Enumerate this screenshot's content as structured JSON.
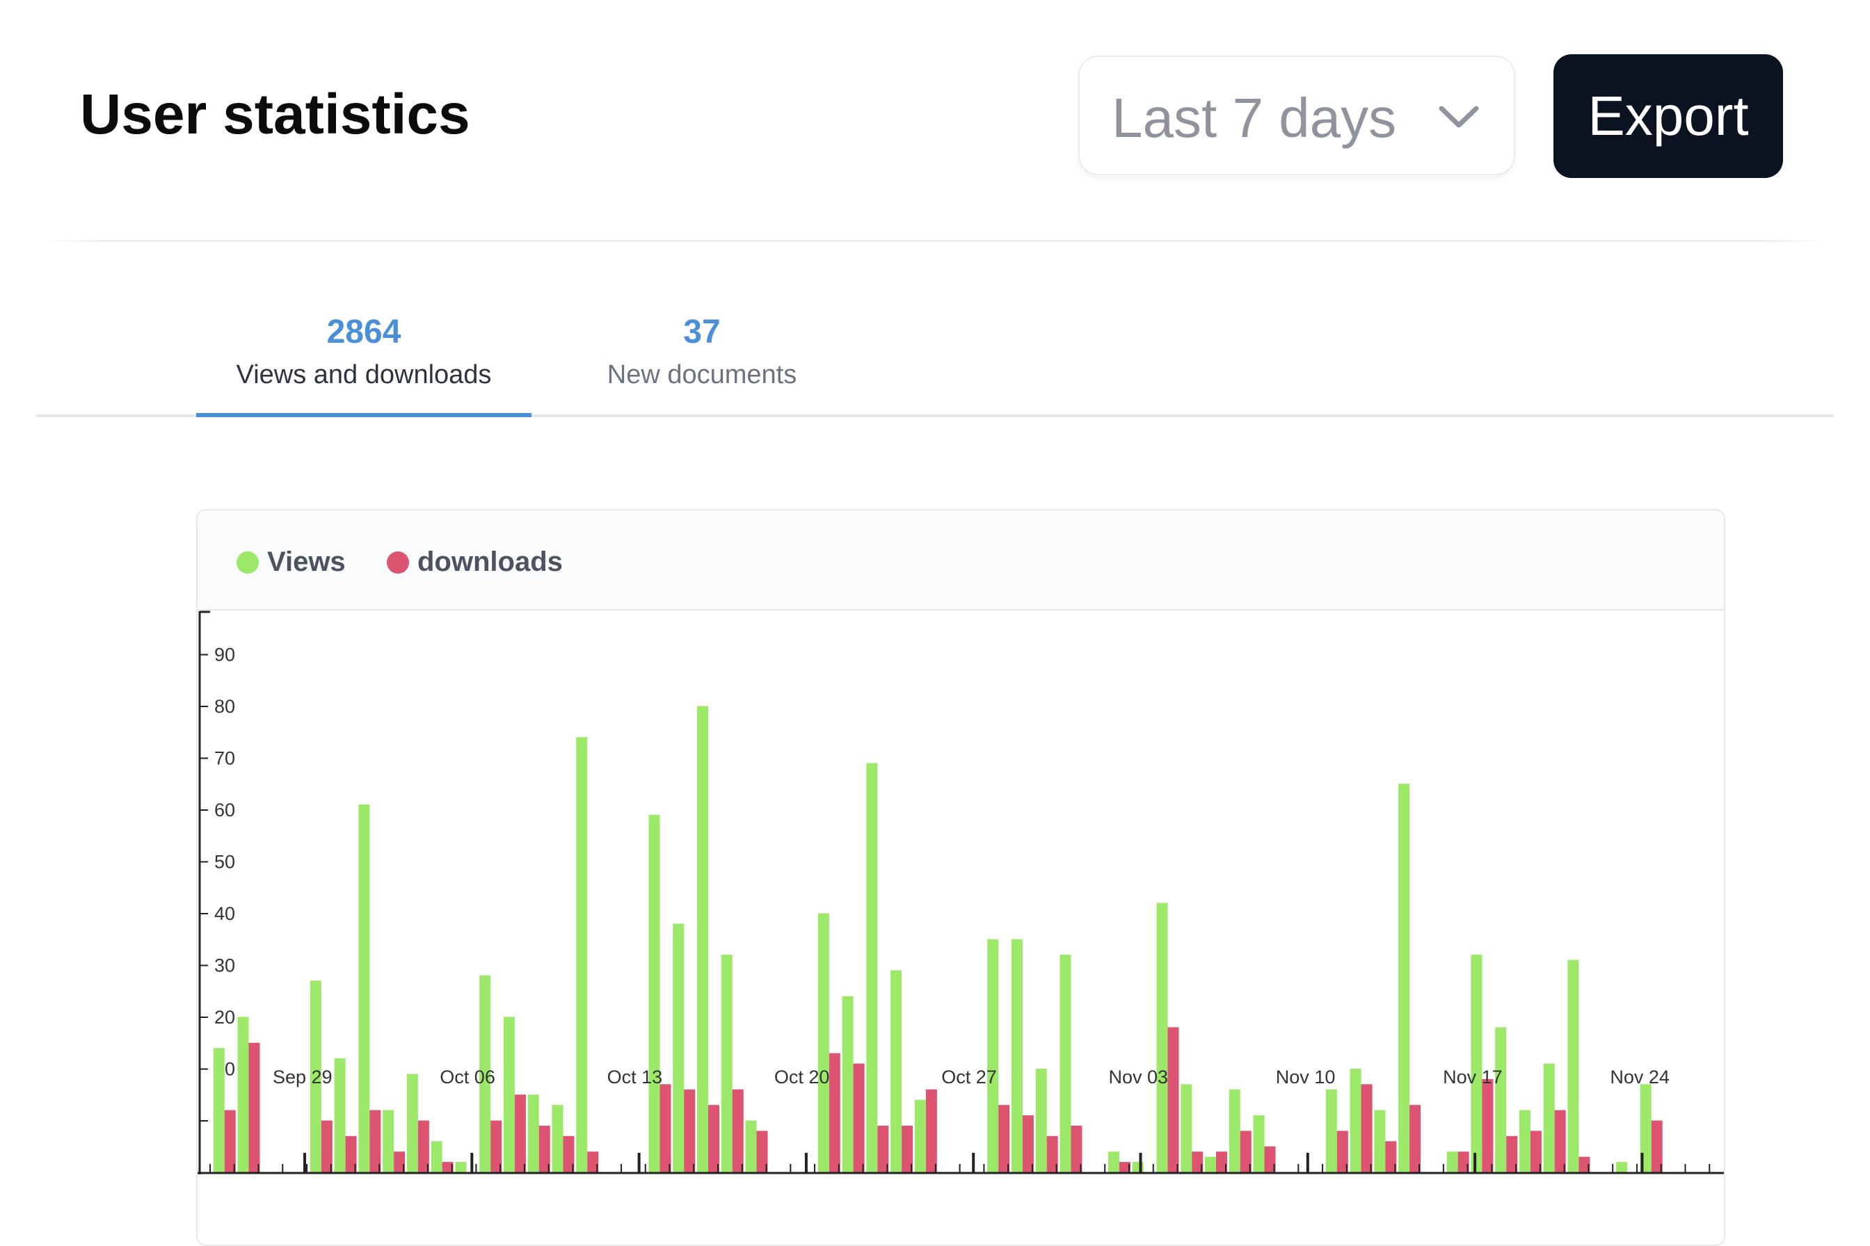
{
  "header": {
    "title": "User statistics",
    "period_select": {
      "value": "Last 7 days",
      "icon": "chevron-down-icon"
    },
    "export_label": "Export"
  },
  "tabs": [
    {
      "count": "2864",
      "label": "Views and downloads",
      "active": true
    },
    {
      "count": "37",
      "label": "New documents",
      "active": false
    }
  ],
  "colors": {
    "views": "#9ce969",
    "downloads": "#dd5470",
    "accent": "#4a90d9",
    "button": "#0b1220"
  },
  "chart_data": {
    "type": "bar",
    "legend": [
      "Views",
      "downloads"
    ],
    "legend_position": "top-left",
    "grid": false,
    "ylim": [
      0,
      100
    ],
    "yticks": [
      0,
      10,
      20,
      30,
      40,
      50,
      60,
      70,
      80,
      90
    ],
    "x_tick_labels": [
      "Sep 29",
      "Oct 06",
      "Oct 13",
      "Oct 20",
      "Oct 27",
      "Nov 03",
      "Nov 10",
      "Nov 17",
      "Nov 24"
    ],
    "x_start": "2024-09-26",
    "x_end": "2024-11-28",
    "series": [
      {
        "name": "Views",
        "points": [
          [
            "2024-09-27",
            24
          ],
          [
            "2024-09-28",
            30
          ],
          [
            "2024-10-01",
            37
          ],
          [
            "2024-10-02",
            22
          ],
          [
            "2024-10-03",
            71
          ],
          [
            "2024-10-04",
            12
          ],
          [
            "2024-10-05",
            19
          ],
          [
            "2024-10-06",
            6
          ],
          [
            "2024-10-07",
            2
          ],
          [
            "2024-10-08",
            38
          ],
          [
            "2024-10-09",
            30
          ],
          [
            "2024-10-10",
            15
          ],
          [
            "2024-10-11",
            13
          ],
          [
            "2024-10-12",
            84
          ],
          [
            "2024-10-15",
            69
          ],
          [
            "2024-10-16",
            48
          ],
          [
            "2024-10-17",
            90
          ],
          [
            "2024-10-18",
            42
          ],
          [
            "2024-10-19",
            10
          ],
          [
            "2024-10-22",
            50
          ],
          [
            "2024-10-23",
            34
          ],
          [
            "2024-10-24",
            79
          ],
          [
            "2024-10-25",
            39
          ],
          [
            "2024-10-26",
            14
          ],
          [
            "2024-10-29",
            45
          ],
          [
            "2024-10-30",
            45
          ],
          [
            "2024-10-31",
            20
          ],
          [
            "2024-11-01",
            42
          ],
          [
            "2024-11-03",
            4
          ],
          [
            "2024-11-04",
            2
          ],
          [
            "2024-11-05",
            52
          ],
          [
            "2024-11-06",
            17
          ],
          [
            "2024-11-07",
            3
          ],
          [
            "2024-11-08",
            16
          ],
          [
            "2024-11-09",
            11
          ],
          [
            "2024-11-12",
            16
          ],
          [
            "2024-11-13",
            20
          ],
          [
            "2024-11-14",
            12
          ],
          [
            "2024-11-15",
            75
          ],
          [
            "2024-11-17",
            4
          ],
          [
            "2024-11-18",
            42
          ],
          [
            "2024-11-19",
            28
          ],
          [
            "2024-11-20",
            12
          ],
          [
            "2024-11-21",
            21
          ],
          [
            "2024-11-22",
            41
          ],
          [
            "2024-11-24",
            2
          ],
          [
            "2024-11-25",
            17
          ]
        ]
      },
      {
        "name": "downloads",
        "points": [
          [
            "2024-09-27",
            12
          ],
          [
            "2024-09-28",
            25
          ],
          [
            "2024-10-01",
            10
          ],
          [
            "2024-10-02",
            7
          ],
          [
            "2024-10-03",
            12
          ],
          [
            "2024-10-04",
            4
          ],
          [
            "2024-10-05",
            10
          ],
          [
            "2024-10-06",
            2
          ],
          [
            "2024-10-08",
            10
          ],
          [
            "2024-10-09",
            15
          ],
          [
            "2024-10-10",
            9
          ],
          [
            "2024-10-11",
            7
          ],
          [
            "2024-10-12",
            4
          ],
          [
            "2024-10-15",
            17
          ],
          [
            "2024-10-16",
            16
          ],
          [
            "2024-10-17",
            13
          ],
          [
            "2024-10-18",
            16
          ],
          [
            "2024-10-19",
            8
          ],
          [
            "2024-10-22",
            23
          ],
          [
            "2024-10-23",
            21
          ],
          [
            "2024-10-24",
            9
          ],
          [
            "2024-10-25",
            9
          ],
          [
            "2024-10-26",
            16
          ],
          [
            "2024-10-29",
            13
          ],
          [
            "2024-10-30",
            11
          ],
          [
            "2024-10-31",
            7
          ],
          [
            "2024-11-01",
            9
          ],
          [
            "2024-11-03",
            2
          ],
          [
            "2024-11-05",
            28
          ],
          [
            "2024-11-06",
            4
          ],
          [
            "2024-11-07",
            4
          ],
          [
            "2024-11-08",
            8
          ],
          [
            "2024-11-09",
            5
          ],
          [
            "2024-11-12",
            8
          ],
          [
            "2024-11-13",
            17
          ],
          [
            "2024-11-14",
            6
          ],
          [
            "2024-11-15",
            13
          ],
          [
            "2024-11-17",
            4
          ],
          [
            "2024-11-18",
            18
          ],
          [
            "2024-11-19",
            7
          ],
          [
            "2024-11-20",
            8
          ],
          [
            "2024-11-21",
            12
          ],
          [
            "2024-11-22",
            3
          ],
          [
            "2024-11-25",
            10
          ]
        ]
      }
    ]
  }
}
